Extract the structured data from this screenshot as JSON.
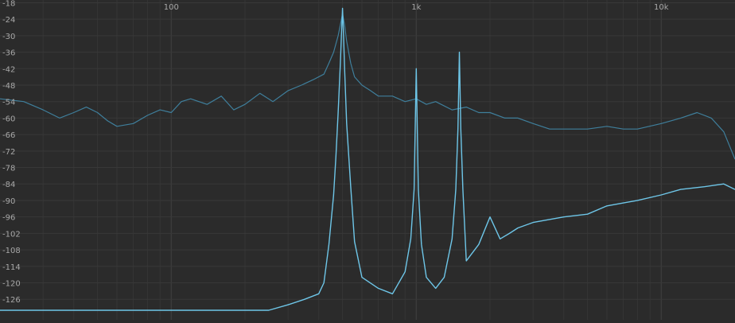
{
  "chart_data": {
    "type": "line",
    "x_scale": "log",
    "xlim": [
      20,
      20000
    ],
    "ylim": [
      -130,
      -17
    ],
    "grid": true,
    "x_ticks": [
      {
        "value": 100,
        "label": "100"
      },
      {
        "value": 1000,
        "label": "1k"
      },
      {
        "value": 10000,
        "label": "10k"
      }
    ],
    "y_ticks": [
      {
        "value": -18,
        "label": "-18"
      },
      {
        "value": -24,
        "label": "-24"
      },
      {
        "value": -30,
        "label": "-30"
      },
      {
        "value": -36,
        "label": "-36"
      },
      {
        "value": -42,
        "label": "-42"
      },
      {
        "value": -48,
        "label": "-48"
      },
      {
        "value": -54,
        "label": "-54"
      },
      {
        "value": -60,
        "label": "-60"
      },
      {
        "value": -66,
        "label": "-66"
      },
      {
        "value": -72,
        "label": "-72"
      },
      {
        "value": -78,
        "label": "-78"
      },
      {
        "value": -84,
        "label": "-84"
      },
      {
        "value": -90,
        "label": "-90"
      },
      {
        "value": -96,
        "label": "-96"
      },
      {
        "value": -102,
        "label": "-102"
      },
      {
        "value": -108,
        "label": "-108"
      },
      {
        "value": -114,
        "label": "-114"
      },
      {
        "value": -120,
        "label": "-120"
      },
      {
        "value": -126,
        "label": "-126"
      }
    ],
    "series": [
      {
        "color": "#3f7f9c",
        "x": [
          20,
          25,
          30,
          35,
          40,
          45,
          50,
          55,
          60,
          70,
          80,
          90,
          100,
          110,
          120,
          140,
          160,
          180,
          200,
          230,
          260,
          300,
          340,
          380,
          420,
          440,
          460,
          480,
          490,
          500,
          510,
          520,
          540,
          560,
          600,
          650,
          700,
          800,
          900,
          1000,
          1100,
          1200,
          1400,
          1600,
          1800,
          2000,
          2300,
          2600,
          3000,
          3500,
          4000,
          5000,
          6000,
          7000,
          8000,
          10000,
          12000,
          14000,
          16000,
          18000,
          20000
        ],
        "y": [
          -53,
          -54,
          -57,
          -60,
          -58,
          -56,
          -58,
          -61,
          -63,
          -62,
          -59,
          -57,
          -58,
          -54,
          -53,
          -55,
          -52,
          -57,
          -55,
          -51,
          -54,
          -50,
          -48,
          -46,
          -44,
          -40,
          -36,
          -30,
          -26,
          -22,
          -26,
          -32,
          -40,
          -45,
          -48,
          -50,
          -52,
          -52,
          -54,
          -53,
          -55,
          -54,
          -57,
          -56,
          -58,
          -58,
          -60,
          -60,
          -62,
          -64,
          -64,
          -64,
          -63,
          -64,
          -64,
          -62,
          -60,
          -58,
          -60,
          -65,
          -75
        ]
      },
      {
        "color": "#6ec6e8",
        "x": [
          20,
          30,
          40,
          60,
          80,
          100,
          150,
          200,
          250,
          300,
          350,
          400,
          420,
          440,
          460,
          470,
          480,
          490,
          495,
          500,
          505,
          510,
          520,
          540,
          560,
          600,
          700,
          800,
          900,
          950,
          980,
          1000,
          1020,
          1050,
          1100,
          1200,
          1300,
          1400,
          1450,
          1480,
          1500,
          1520,
          1550,
          1600,
          1800,
          2000,
          2200,
          2400,
          2600,
          3000,
          4000,
          5000,
          6000,
          8000,
          10000,
          12000,
          15000,
          18000,
          20000
        ],
        "y": [
          -130,
          -130,
          -130,
          -130,
          -130,
          -130,
          -130,
          -130,
          -130,
          -128,
          -126,
          -124,
          -120,
          -106,
          -88,
          -74,
          -58,
          -40,
          -30,
          -20,
          -30,
          -42,
          -62,
          -85,
          -105,
          -118,
          -122,
          -124,
          -116,
          -104,
          -86,
          -42,
          -86,
          -106,
          -118,
          -122,
          -118,
          -104,
          -86,
          -64,
          -36,
          -64,
          -86,
          -112,
          -106,
          -96,
          -104,
          -102,
          -100,
          -98,
          -96,
          -95,
          -92,
          -90,
          -88,
          -86,
          -85,
          -84,
          -86
        ]
      }
    ]
  }
}
